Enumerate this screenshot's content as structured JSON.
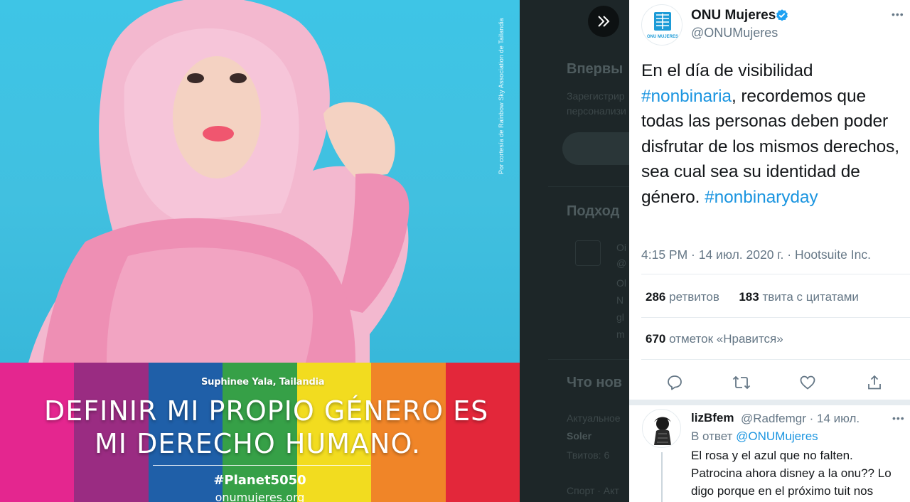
{
  "media": {
    "photo_credit": "Por cortesía de Rainbow Sky Association de Tailandia",
    "person_label": "Suphinee Yala, Tailandia",
    "slogan_line1": "DEFINIR MI PROPIO GÉNERO ES",
    "slogan_line2": "MI DERECHO HUMANO.",
    "hashtag": "#Planet5050",
    "site": "onumujeres.org",
    "rainbow_colors": [
      "#e4268f",
      "#9a2c82",
      "#1f5fa8",
      "#36a047",
      "#f2dc1f",
      "#f08528",
      "#e3273a"
    ]
  },
  "background_page": {
    "heading1": "Впервы",
    "line1": "Зарегистрир",
    "line2": "персонализи",
    "heading2": "Подход",
    "row1": "Oi",
    "row2": "@",
    "row3": "Ol",
    "row4": "N",
    "row5": "gl",
    "row6": "m",
    "heading3": "Что нов",
    "line3": "Актуальное",
    "line4": "Soler",
    "line5": "Твитов: 6",
    "line6": "Спорт · Акт"
  },
  "tweet": {
    "display_name": "ONU Mujeres",
    "handle": "@ONUMujeres",
    "avatar_caption": "ONU MUJERES",
    "text_1": "En el día de visibilidad ",
    "tag_1": "#nonbinaria",
    "text_2": ", recordemos que todas las personas deben poder disfrutar de los mismos derechos, sea cual sea su identidad de género. ",
    "tag_2": "#nonbinaryday",
    "meta": "4:15 PM · 14 июл. 2020 г. · Hootsuite Inc.",
    "retweets_count": "286",
    "retweets_label": "ретвитов",
    "quotes_count": "183",
    "quotes_label": "твита с цитатами",
    "likes_count": "670",
    "likes_label": "отметок «Нравится»",
    "icons": [
      "reply-icon",
      "retweet-icon",
      "like-icon",
      "share-icon",
      "verified-icon",
      "more-icon",
      "expand-icon"
    ]
  },
  "reply": {
    "name": "lizBfem",
    "handle_time": "@Radfemgr · 14 июл.",
    "reply_prefix": "В ответ ",
    "reply_to": "@ONUMujeres",
    "text": "El rosa y el azul que no falten. Patrocina ahora disney a la onu?? Lo digo porque en el próximo tuit nos podrán contar lo de la sirenita"
  },
  "colors": {
    "link": "#1b95e0",
    "text": "#14171a",
    "muted": "#657786",
    "photo_bg": "#3fc3e3"
  }
}
